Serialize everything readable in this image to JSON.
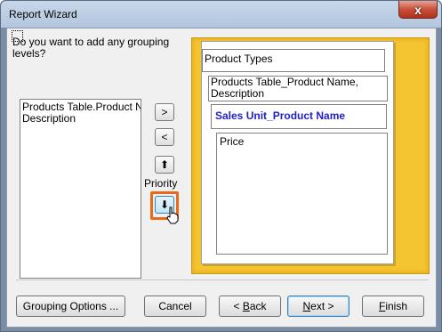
{
  "window": {
    "title": "Report Wizard",
    "close_glyph": "x"
  },
  "prompt": {
    "question": "Do you want to add any grouping levels?"
  },
  "available_fields": [
    "Products Table.Product Nar",
    "Description"
  ],
  "mover_buttons": {
    "add": ">",
    "remove": "<",
    "priority_up": "⬆",
    "priority_down": "⬇",
    "priority_label": "Priority"
  },
  "preview": {
    "level1": "Product Types",
    "level2_line1": "Products Table_Product Name,",
    "level2_line2": "Description",
    "level3": "Sales Unit_Product Name",
    "detail": "Price"
  },
  "footer": {
    "grouping_options": "Grouping Options ...",
    "cancel": "Cancel",
    "back_prefix": "< ",
    "back_mnemonic": "B",
    "back_rest": "ack",
    "next_mnemonic": "N",
    "next_rest": "ext >",
    "finish_mnemonic": "F",
    "finish_rest": "inish"
  },
  "colors": {
    "accent_highlight": "#e86a14",
    "preview_background": "#f4c431",
    "selected_group_text": "#1f1fc8"
  }
}
